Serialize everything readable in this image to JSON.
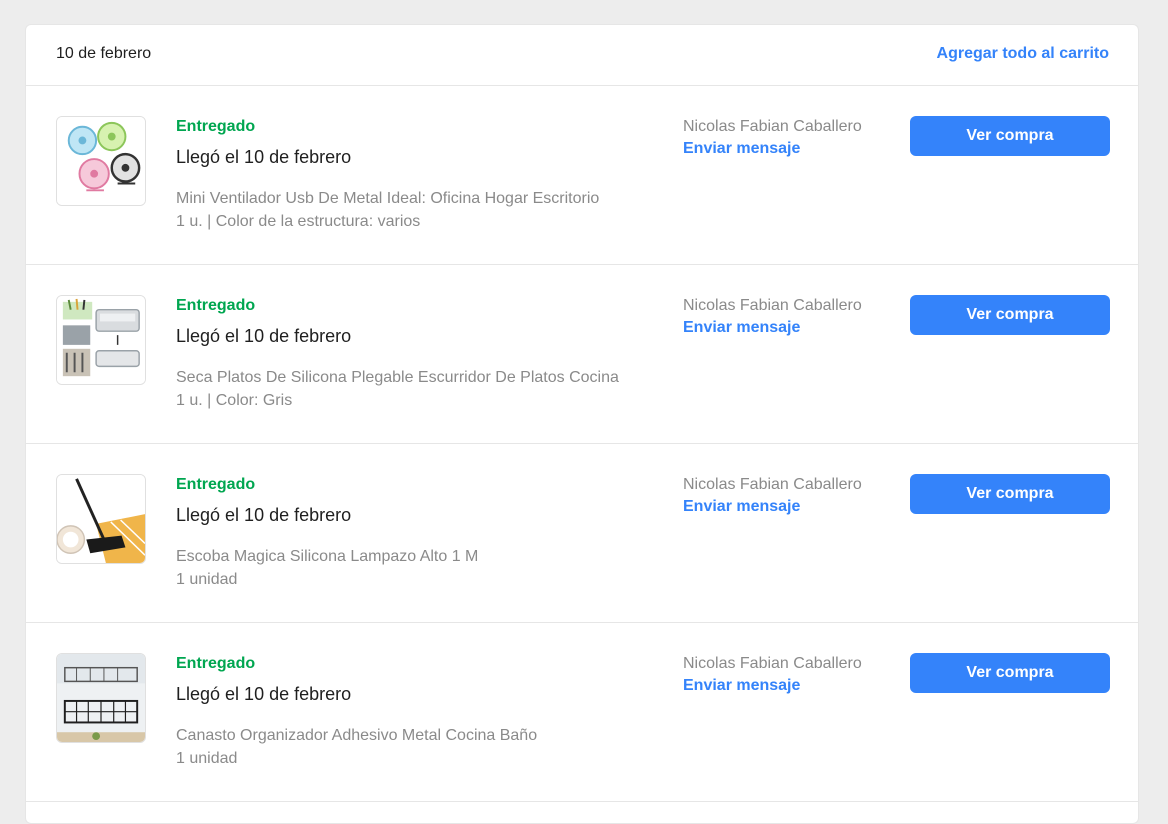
{
  "header": {
    "date": "10 de febrero",
    "add_all_label": "Agregar todo al carrito"
  },
  "colors": {
    "accent": "#3483fa",
    "delivered": "#00a650",
    "muted_text": "#8a8a8a"
  },
  "orders": [
    {
      "image": "mini-fan-product-image",
      "status": "Entregado",
      "arrival": "Llegó el 10 de febrero",
      "title": "Mini Ventilador Usb De Metal Ideal: Oficina Hogar Escritorio",
      "variant": "1 u. | Color de la estructura: varios",
      "seller": "Nicolas Fabian Caballero",
      "message_label": "Enviar mensaje",
      "button_label": "Ver compra"
    },
    {
      "image": "dish-rack-product-image",
      "status": "Entregado",
      "arrival": "Llegó el 10 de febrero",
      "title": "Seca Platos De Silicona Plegable Escurridor De Platos Cocina",
      "variant": "1 u. | Color: Gris",
      "seller": "Nicolas Fabian Caballero",
      "message_label": "Enviar mensaje",
      "button_label": "Ver compra"
    },
    {
      "image": "squeegee-broom-product-image",
      "status": "Entregado",
      "arrival": "Llegó el 10 de febrero",
      "title": "Escoba Magica Silicona Lampazo Alto 1 M",
      "variant": "1 unidad",
      "seller": "Nicolas Fabian Caballero",
      "message_label": "Enviar mensaje",
      "button_label": "Ver compra"
    },
    {
      "image": "wire-basket-product-image",
      "status": "Entregado",
      "arrival": "Llegó el 10 de febrero",
      "title": "Canasto Organizador Adhesivo Metal Cocina Baño",
      "variant": "1 unidad",
      "seller": "Nicolas Fabian Caballero",
      "message_label": "Enviar mensaje",
      "button_label": "Ver compra"
    }
  ]
}
